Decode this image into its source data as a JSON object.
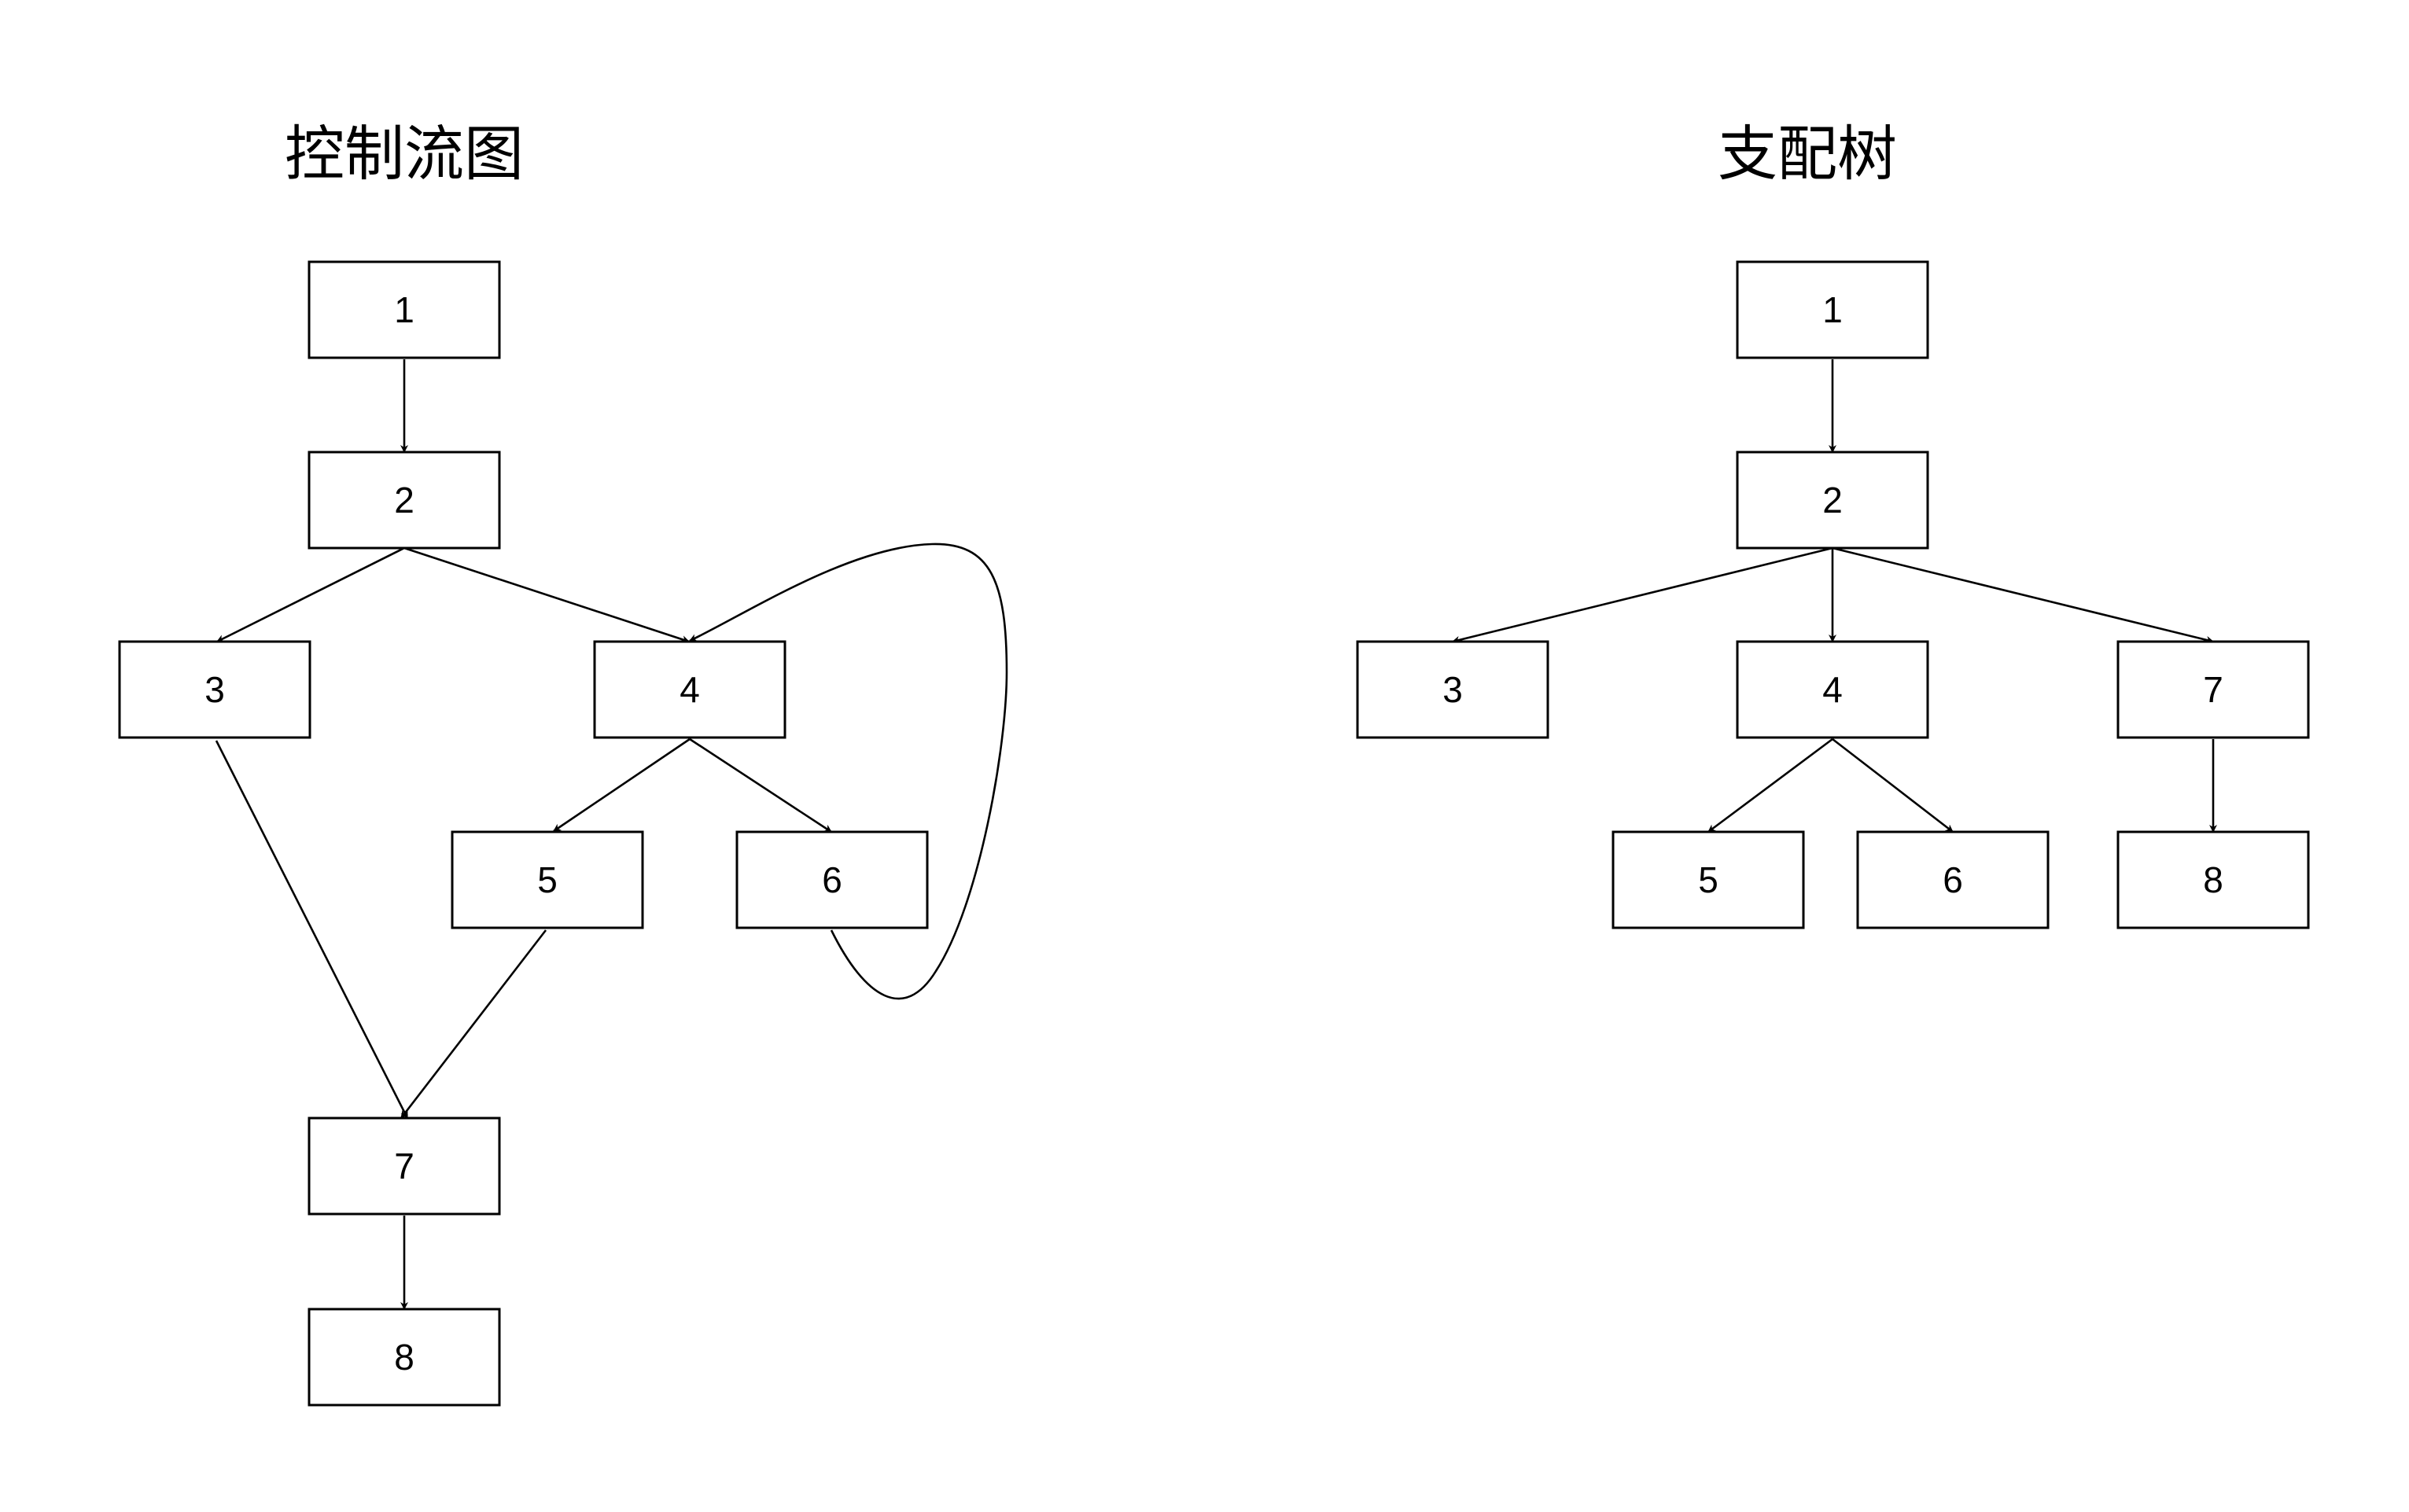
{
  "colors": {
    "background": "#ffffff",
    "stroke": "#000000",
    "text": "#000000"
  },
  "left": {
    "title": "控制流图",
    "nodes": [
      "1",
      "2",
      "3",
      "4",
      "5",
      "6",
      "7",
      "8"
    ],
    "edges": [
      {
        "from": "1",
        "to": "2"
      },
      {
        "from": "2",
        "to": "3"
      },
      {
        "from": "2",
        "to": "4"
      },
      {
        "from": "3",
        "to": "7"
      },
      {
        "from": "4",
        "to": "5"
      },
      {
        "from": "4",
        "to": "6"
      },
      {
        "from": "5",
        "to": "7"
      },
      {
        "from": "6",
        "to": "4"
      },
      {
        "from": "7",
        "to": "8"
      }
    ]
  },
  "right": {
    "title": "支配树",
    "nodes": [
      "1",
      "2",
      "3",
      "4",
      "7",
      "5",
      "6",
      "8"
    ],
    "edges": [
      {
        "from": "1",
        "to": "2"
      },
      {
        "from": "2",
        "to": "3"
      },
      {
        "from": "2",
        "to": "4"
      },
      {
        "from": "2",
        "to": "7"
      },
      {
        "from": "4",
        "to": "5"
      },
      {
        "from": "4",
        "to": "6"
      },
      {
        "from": "7",
        "to": "8"
      }
    ]
  }
}
